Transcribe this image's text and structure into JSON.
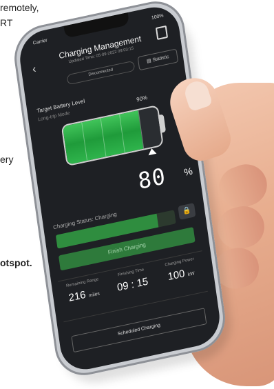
{
  "background_text": {
    "line1": "remotely,",
    "line2": "RT",
    "line3": "ery",
    "line4": "otspot."
  },
  "status_bar": {
    "carrier": "Carrier",
    "battery": "100%"
  },
  "header": {
    "title": "Charging Management",
    "updated": "Updated Time: 05-09-2022 09:03:15",
    "connection_status": "Disconnected",
    "statistic_button": "Statistic"
  },
  "battery": {
    "target_label": "Target Battery Level",
    "target_value": "90%",
    "mode": "Long-trip Mode",
    "current_percent": 80,
    "current_display": "80",
    "percent_sign": "%",
    "target_fraction": 0.9
  },
  "charging": {
    "status": "Charging Status: Charging",
    "progress_fraction": 0.85,
    "finish_button": "Finish Charging"
  },
  "metrics": [
    {
      "label": "Remaining Range",
      "value": "216",
      "unit": "miles"
    },
    {
      "label": "Finishing Time",
      "value": "09 : 15",
      "unit": ""
    },
    {
      "label": "Charging Power",
      "value": "100",
      "unit": "kW"
    }
  ],
  "scheduled_button": "Scheduled Charging",
  "colors": {
    "accent_green": "#2f8d3f",
    "battery_green": "#41c45a",
    "screen_bg": "#1e2024"
  },
  "icons": [
    "back-chevron-icon",
    "ev-station-icon",
    "statistic-icon",
    "lock-icon"
  ]
}
